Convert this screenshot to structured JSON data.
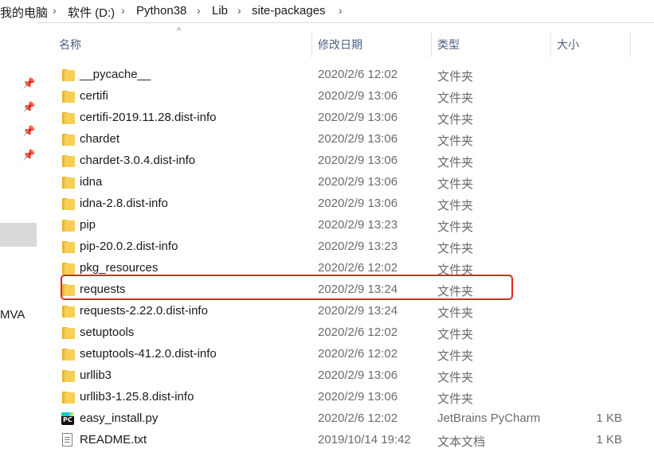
{
  "breadcrumb": [
    "我的电脑",
    "软件 (D:)",
    "Python38",
    "Lib",
    "site-packages"
  ],
  "nav": {
    "partial_label": "MVA"
  },
  "columns": {
    "name": "名称",
    "date": "修改日期",
    "type": "类型",
    "size": "大小"
  },
  "files": [
    {
      "name": "__pycache__",
      "date": "2020/2/6 12:02",
      "type": "文件夹",
      "size": "",
      "icon": "folder-icon"
    },
    {
      "name": "certifi",
      "date": "2020/2/9 13:06",
      "type": "文件夹",
      "size": "",
      "icon": "folder-icon"
    },
    {
      "name": "certifi-2019.11.28.dist-info",
      "date": "2020/2/9 13:06",
      "type": "文件夹",
      "size": "",
      "icon": "folder-icon"
    },
    {
      "name": "chardet",
      "date": "2020/2/9 13:06",
      "type": "文件夹",
      "size": "",
      "icon": "folder-icon"
    },
    {
      "name": "chardet-3.0.4.dist-info",
      "date": "2020/2/9 13:06",
      "type": "文件夹",
      "size": "",
      "icon": "folder-icon"
    },
    {
      "name": "idna",
      "date": "2020/2/9 13:06",
      "type": "文件夹",
      "size": "",
      "icon": "folder-icon"
    },
    {
      "name": "idna-2.8.dist-info",
      "date": "2020/2/9 13:06",
      "type": "文件夹",
      "size": "",
      "icon": "folder-icon"
    },
    {
      "name": "pip",
      "date": "2020/2/9 13:23",
      "type": "文件夹",
      "size": "",
      "icon": "folder-icon"
    },
    {
      "name": "pip-20.0.2.dist-info",
      "date": "2020/2/9 13:23",
      "type": "文件夹",
      "size": "",
      "icon": "folder-icon"
    },
    {
      "name": "pkg_resources",
      "date": "2020/2/6 12:02",
      "type": "文件夹",
      "size": "",
      "icon": "folder-icon"
    },
    {
      "name": "requests",
      "date": "2020/2/9 13:24",
      "type": "文件夹",
      "size": "",
      "icon": "folder-icon"
    },
    {
      "name": "requests-2.22.0.dist-info",
      "date": "2020/2/9 13:24",
      "type": "文件夹",
      "size": "",
      "icon": "folder-icon"
    },
    {
      "name": "setuptools",
      "date": "2020/2/6 12:02",
      "type": "文件夹",
      "size": "",
      "icon": "folder-icon"
    },
    {
      "name": "setuptools-41.2.0.dist-info",
      "date": "2020/2/6 12:02",
      "type": "文件夹",
      "size": "",
      "icon": "folder-icon"
    },
    {
      "name": "urllib3",
      "date": "2020/2/9 13:06",
      "type": "文件夹",
      "size": "",
      "icon": "folder-icon"
    },
    {
      "name": "urllib3-1.25.8.dist-info",
      "date": "2020/2/9 13:06",
      "type": "文件夹",
      "size": "",
      "icon": "folder-icon"
    },
    {
      "name": "easy_install.py",
      "date": "2020/2/6 12:02",
      "type": "JetBrains PyCharm",
      "size": "1 KB",
      "icon": "pycharm-file-icon"
    },
    {
      "name": "README.txt",
      "date": "2019/10/14 19:42",
      "type": "文本文档",
      "size": "1 KB",
      "icon": "text-file-icon"
    }
  ],
  "highlighted_item": "requests",
  "colors": {
    "folder": "#f6cf54",
    "highlight": "#e8221d",
    "header_text": "#4d6082"
  }
}
